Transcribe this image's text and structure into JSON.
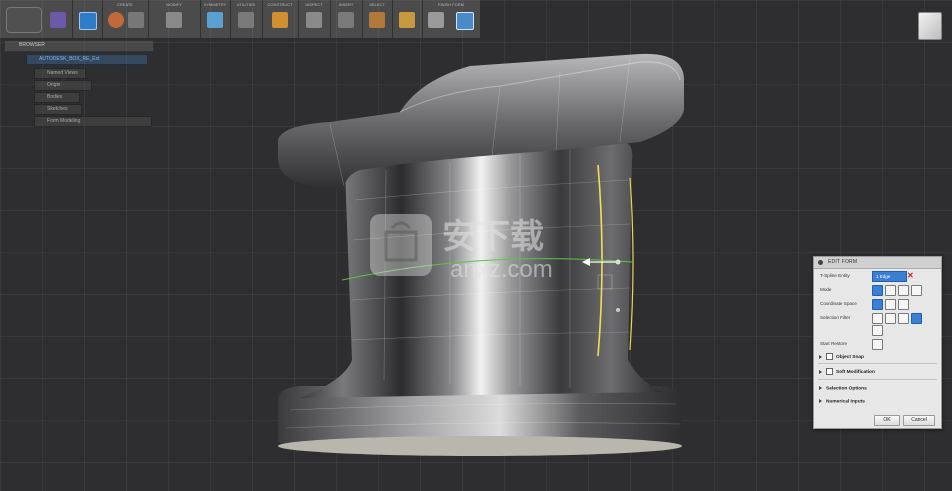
{
  "toolbar": {
    "groups": [
      "",
      "",
      "CREATE",
      "MODIFY",
      "SYMMETRY",
      "UTILITIES",
      "CONSTRUCT",
      "INSPECT",
      "INSERT",
      "SELECT",
      "FINISH FORM"
    ],
    "colors": {
      "accent": "#3a7fd5",
      "chip": "#f0c030"
    }
  },
  "browser": {
    "title": "BROWSER",
    "items": [
      {
        "label": "AUTODESK_BOX_RE_Ext"
      },
      {
        "label": "Named Views"
      },
      {
        "label": "Origin"
      },
      {
        "label": "Bodies"
      },
      {
        "label": "Sketches"
      },
      {
        "label": "Form Modeling"
      }
    ]
  },
  "viewcube": {
    "icon": "view-cube-icon"
  },
  "watermark": {
    "brand_cn": "安下载",
    "domain": "anxz.com"
  },
  "panel": {
    "title": "EDIT FORM",
    "rows": {
      "tspline_entity": "T-Spline Entity",
      "mode": "Mode",
      "coordinate_space": "Coordinate Space",
      "selection_filter": "Selection Filter",
      "start_restore": "Start Restore"
    },
    "entity_value": "1 Edge",
    "object_snap": "Object Snap",
    "soft_modification": "Soft Modification",
    "selection_options": "Selection Options",
    "numerical_inputs": "Numerical Inputs",
    "ok": "OK",
    "cancel": "Cancel"
  }
}
